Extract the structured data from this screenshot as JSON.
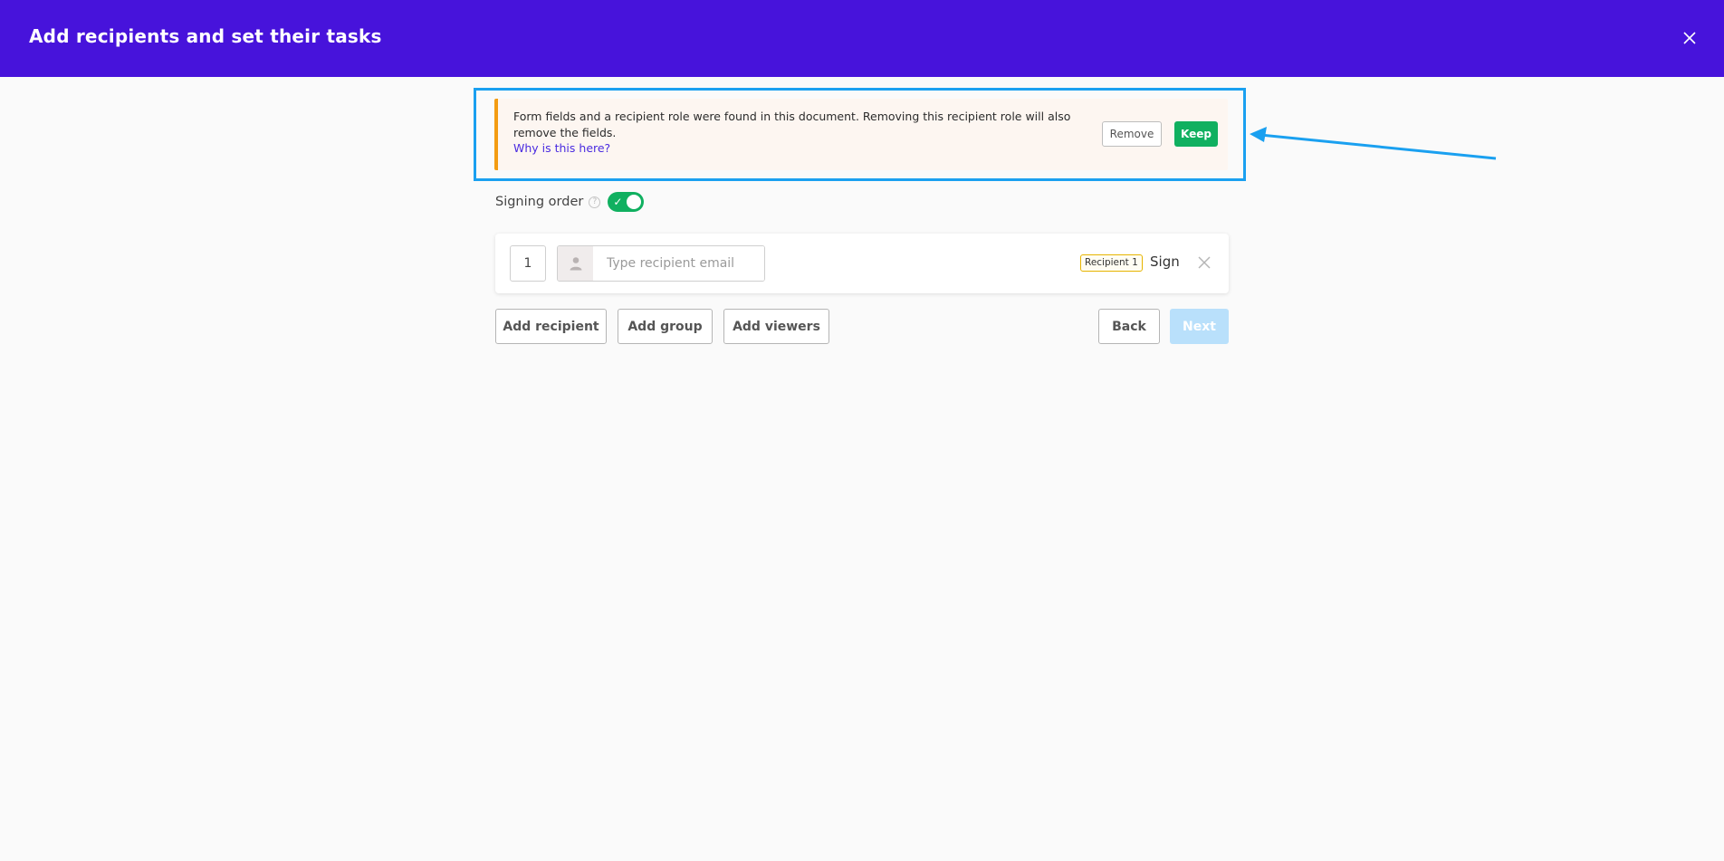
{
  "header": {
    "title": "Add recipients and set their tasks",
    "bg_color": "#4713db"
  },
  "alert": {
    "message": "Form fields and a recipient role were found in this document. Removing this recipient role will also remove the fields.",
    "link_text": "Why is this here?",
    "remove_label": "Remove",
    "keep_label": "Keep",
    "accent_color": "#f39c12"
  },
  "signing_order": {
    "label": "Signing order",
    "enabled": true,
    "toggle_color": "#10b060"
  },
  "recipients": [
    {
      "order": "1",
      "email_value": "",
      "email_placeholder": "Type recipient email",
      "role": "Recipient 1",
      "task": "Sign"
    }
  ],
  "actions": {
    "add_recipient": "Add recipient",
    "add_group": "Add group",
    "add_viewers": "Add viewers",
    "back": "Back",
    "next": "Next"
  },
  "annotation": {
    "highlight_color": "#1aa0f0"
  }
}
